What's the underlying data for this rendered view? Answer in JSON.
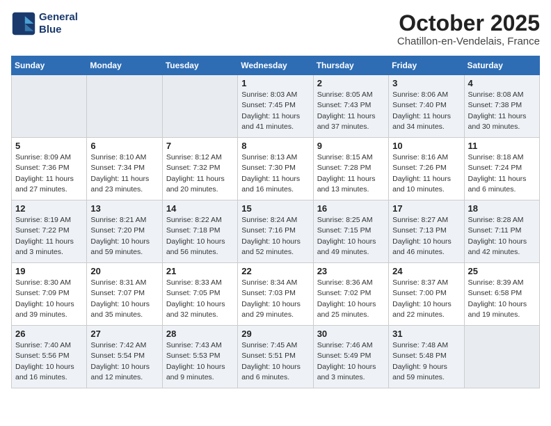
{
  "header": {
    "logo_line1": "General",
    "logo_line2": "Blue",
    "month": "October 2025",
    "location": "Chatillon-en-Vendelais, France"
  },
  "weekdays": [
    "Sunday",
    "Monday",
    "Tuesday",
    "Wednesday",
    "Thursday",
    "Friday",
    "Saturday"
  ],
  "weeks": [
    [
      {
        "day": "",
        "info": ""
      },
      {
        "day": "",
        "info": ""
      },
      {
        "day": "",
        "info": ""
      },
      {
        "day": "1",
        "info": "Sunrise: 8:03 AM\nSunset: 7:45 PM\nDaylight: 11 hours and 41 minutes."
      },
      {
        "day": "2",
        "info": "Sunrise: 8:05 AM\nSunset: 7:43 PM\nDaylight: 11 hours and 37 minutes."
      },
      {
        "day": "3",
        "info": "Sunrise: 8:06 AM\nSunset: 7:40 PM\nDaylight: 11 hours and 34 minutes."
      },
      {
        "day": "4",
        "info": "Sunrise: 8:08 AM\nSunset: 7:38 PM\nDaylight: 11 hours and 30 minutes."
      }
    ],
    [
      {
        "day": "5",
        "info": "Sunrise: 8:09 AM\nSunset: 7:36 PM\nDaylight: 11 hours and 27 minutes."
      },
      {
        "day": "6",
        "info": "Sunrise: 8:10 AM\nSunset: 7:34 PM\nDaylight: 11 hours and 23 minutes."
      },
      {
        "day": "7",
        "info": "Sunrise: 8:12 AM\nSunset: 7:32 PM\nDaylight: 11 hours and 20 minutes."
      },
      {
        "day": "8",
        "info": "Sunrise: 8:13 AM\nSunset: 7:30 PM\nDaylight: 11 hours and 16 minutes."
      },
      {
        "day": "9",
        "info": "Sunrise: 8:15 AM\nSunset: 7:28 PM\nDaylight: 11 hours and 13 minutes."
      },
      {
        "day": "10",
        "info": "Sunrise: 8:16 AM\nSunset: 7:26 PM\nDaylight: 11 hours and 10 minutes."
      },
      {
        "day": "11",
        "info": "Sunrise: 8:18 AM\nSunset: 7:24 PM\nDaylight: 11 hours and 6 minutes."
      }
    ],
    [
      {
        "day": "12",
        "info": "Sunrise: 8:19 AM\nSunset: 7:22 PM\nDaylight: 11 hours and 3 minutes."
      },
      {
        "day": "13",
        "info": "Sunrise: 8:21 AM\nSunset: 7:20 PM\nDaylight: 10 hours and 59 minutes."
      },
      {
        "day": "14",
        "info": "Sunrise: 8:22 AM\nSunset: 7:18 PM\nDaylight: 10 hours and 56 minutes."
      },
      {
        "day": "15",
        "info": "Sunrise: 8:24 AM\nSunset: 7:16 PM\nDaylight: 10 hours and 52 minutes."
      },
      {
        "day": "16",
        "info": "Sunrise: 8:25 AM\nSunset: 7:15 PM\nDaylight: 10 hours and 49 minutes."
      },
      {
        "day": "17",
        "info": "Sunrise: 8:27 AM\nSunset: 7:13 PM\nDaylight: 10 hours and 46 minutes."
      },
      {
        "day": "18",
        "info": "Sunrise: 8:28 AM\nSunset: 7:11 PM\nDaylight: 10 hours and 42 minutes."
      }
    ],
    [
      {
        "day": "19",
        "info": "Sunrise: 8:30 AM\nSunset: 7:09 PM\nDaylight: 10 hours and 39 minutes."
      },
      {
        "day": "20",
        "info": "Sunrise: 8:31 AM\nSunset: 7:07 PM\nDaylight: 10 hours and 35 minutes."
      },
      {
        "day": "21",
        "info": "Sunrise: 8:33 AM\nSunset: 7:05 PM\nDaylight: 10 hours and 32 minutes."
      },
      {
        "day": "22",
        "info": "Sunrise: 8:34 AM\nSunset: 7:03 PM\nDaylight: 10 hours and 29 minutes."
      },
      {
        "day": "23",
        "info": "Sunrise: 8:36 AM\nSunset: 7:02 PM\nDaylight: 10 hours and 25 minutes."
      },
      {
        "day": "24",
        "info": "Sunrise: 8:37 AM\nSunset: 7:00 PM\nDaylight: 10 hours and 22 minutes."
      },
      {
        "day": "25",
        "info": "Sunrise: 8:39 AM\nSunset: 6:58 PM\nDaylight: 10 hours and 19 minutes."
      }
    ],
    [
      {
        "day": "26",
        "info": "Sunrise: 7:40 AM\nSunset: 5:56 PM\nDaylight: 10 hours and 16 minutes."
      },
      {
        "day": "27",
        "info": "Sunrise: 7:42 AM\nSunset: 5:54 PM\nDaylight: 10 hours and 12 minutes."
      },
      {
        "day": "28",
        "info": "Sunrise: 7:43 AM\nSunset: 5:53 PM\nDaylight: 10 hours and 9 minutes."
      },
      {
        "day": "29",
        "info": "Sunrise: 7:45 AM\nSunset: 5:51 PM\nDaylight: 10 hours and 6 minutes."
      },
      {
        "day": "30",
        "info": "Sunrise: 7:46 AM\nSunset: 5:49 PM\nDaylight: 10 hours and 3 minutes."
      },
      {
        "day": "31",
        "info": "Sunrise: 7:48 AM\nSunset: 5:48 PM\nDaylight: 9 hours and 59 minutes."
      },
      {
        "day": "",
        "info": ""
      }
    ]
  ]
}
